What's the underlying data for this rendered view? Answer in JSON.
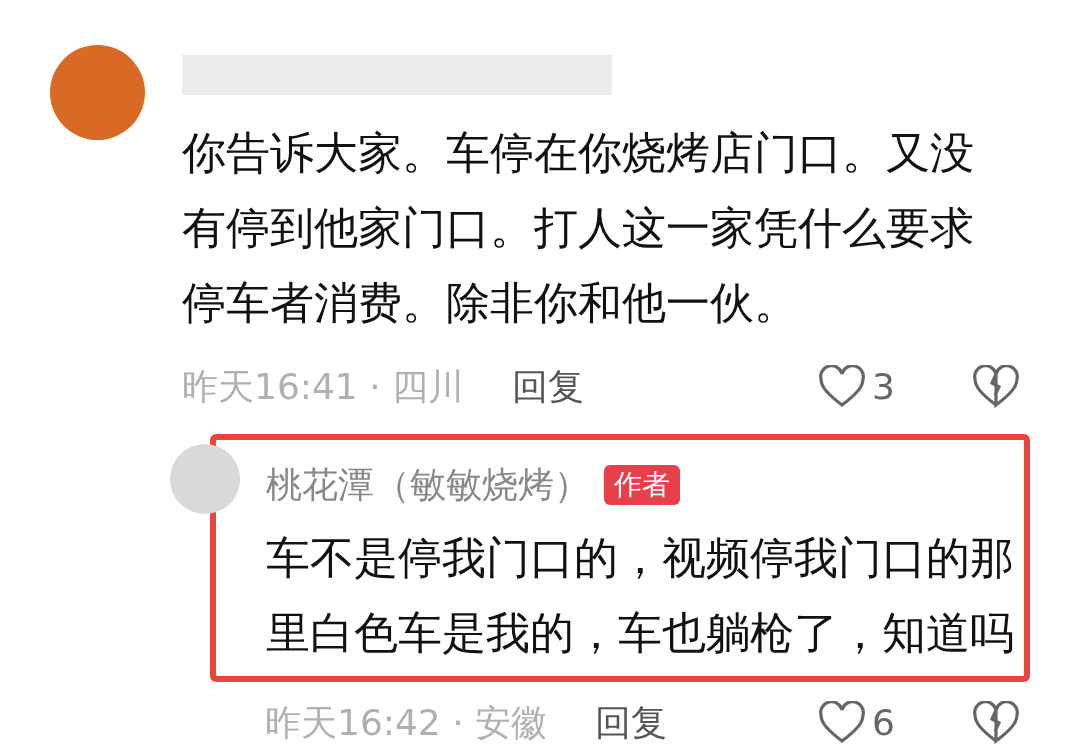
{
  "comments": [
    {
      "author_hidden": true,
      "text": "你告诉大家。车停在你烧烤店门口。又没有停到他家门口。打人这一家凭什么要求停车者消费。除非你和他一伙。",
      "time": "昨天16:41 · 四川",
      "reply": "回复",
      "likes": "3",
      "highlighted": false
    },
    {
      "author": "桃花潭（敏敏烧烤）",
      "badge": "作者",
      "text": "车不是停我门口的，视频停我门口的那里白色车是我的，车也躺枪了，知道吗",
      "time": "昨天16:42 · 安徽",
      "reply": "回复",
      "likes": "6",
      "highlighted": true
    }
  ]
}
